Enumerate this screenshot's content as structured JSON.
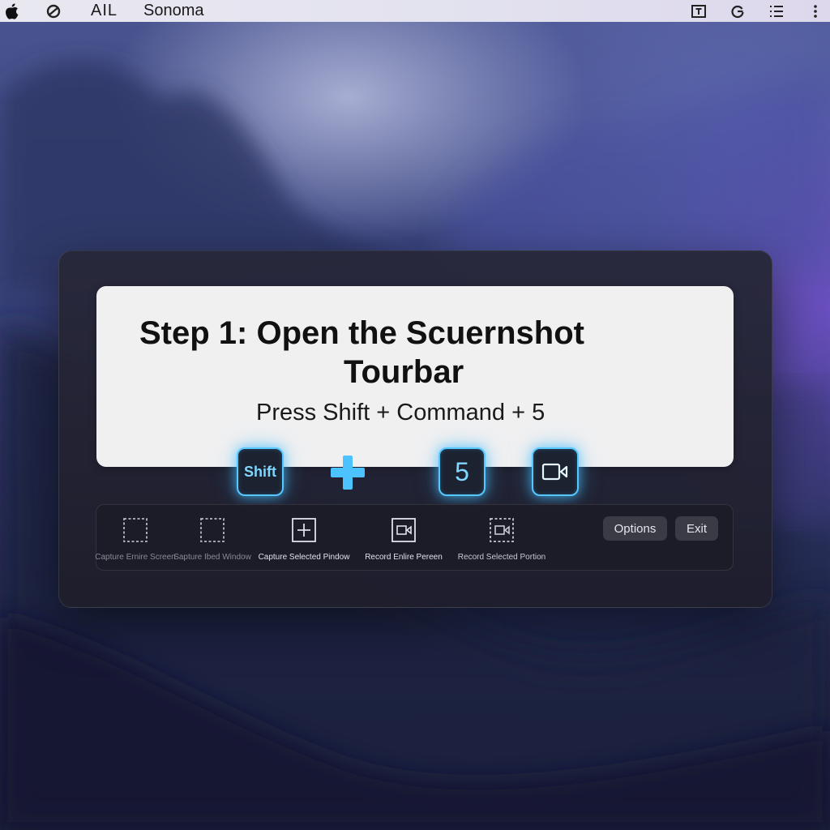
{
  "menubar": {
    "apple_icon": "apple-icon",
    "control_icon": "control-center-icon",
    "menu_all": "AIL",
    "app_name": "Sonoma",
    "right_icons": [
      "text-box-icon",
      "refresh-icon",
      "list-icon",
      "more-vertical-icon"
    ]
  },
  "card": {
    "title_line1": "Step 1: Open the Scuernshot",
    "title_line2": "Tourbar",
    "subtitle": "Press Shift + Command + 5"
  },
  "keys": {
    "shift_label": "Shift",
    "five_label": "5",
    "record_icon": "video-camera-icon",
    "plus_icon": "plus-icon"
  },
  "toolbar": {
    "tools": [
      {
        "label": "Capture Ernire Screen",
        "icon": "dashed-rectangle-icon"
      },
      {
        "label": "Sapture Ibed Window",
        "icon": "dashed-window-icon"
      },
      {
        "label": "Capture Selected Pindow",
        "icon": "plus-box-icon"
      },
      {
        "label": "Record Enlire Pereen",
        "icon": "record-screen-icon"
      },
      {
        "label": "Record Selected Portion",
        "icon": "record-portion-icon"
      }
    ],
    "options_label": "Options",
    "exit_label": "Exit"
  },
  "colors": {
    "key_glow": "#56c7ff",
    "panel_bg": "#262636",
    "card_bg": "#f0f0f1",
    "menubar_bg": "#e6e5ef"
  }
}
